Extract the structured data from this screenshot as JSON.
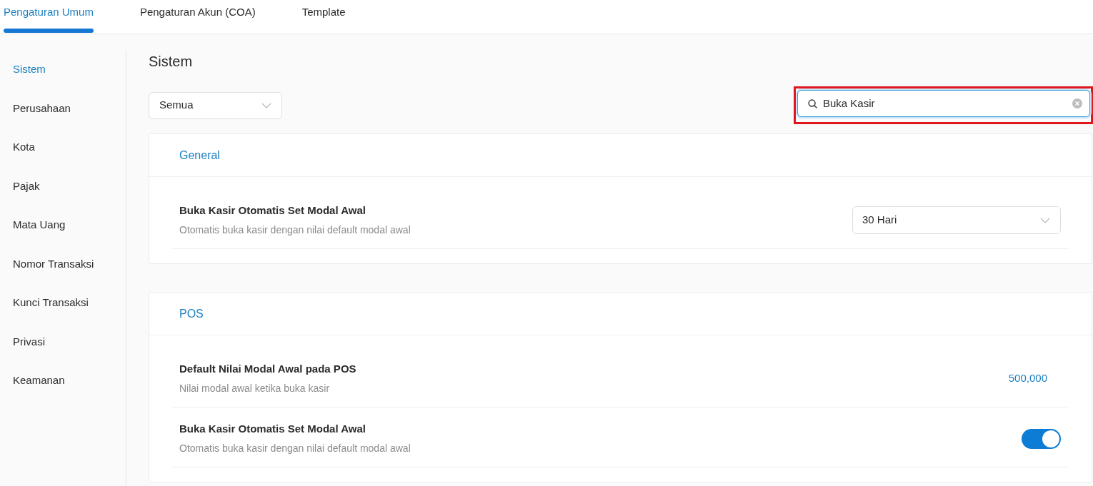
{
  "tabs": [
    {
      "label": "Pengaturan Umum",
      "selected": true
    },
    {
      "label": "Pengaturan Akun (COA)",
      "selected": false
    },
    {
      "label": "Template",
      "selected": false
    }
  ],
  "sidebar": {
    "items": [
      {
        "label": "Sistem",
        "selected": true
      },
      {
        "label": "Perusahaan",
        "selected": false
      },
      {
        "label": "Kota",
        "selected": false
      },
      {
        "label": "Pajak",
        "selected": false
      },
      {
        "label": "Mata Uang",
        "selected": false
      },
      {
        "label": "Nomor Transaksi",
        "selected": false
      },
      {
        "label": "Kunci Transaksi",
        "selected": false
      },
      {
        "label": "Privasi",
        "selected": false
      },
      {
        "label": "Keamanan",
        "selected": false
      }
    ]
  },
  "page": {
    "title": "Sistem",
    "filter": {
      "value": "Semua"
    },
    "search": {
      "value": "Buka Kasir",
      "highlighted": true
    }
  },
  "sections": [
    {
      "title": "General",
      "settings": [
        {
          "kind": "select",
          "title": "Buka Kasir Otomatis Set Modal Awal",
          "description": "Otomatis buka kasir dengan nilai default modal awal",
          "value": "30 Hari"
        }
      ]
    },
    {
      "title": "POS",
      "settings": [
        {
          "kind": "value",
          "title": "Default Nilai Modal Awal pada POS",
          "description": "Nilai modal awal ketika buka kasir",
          "value": "500,000"
        },
        {
          "kind": "toggle",
          "title": "Buka Kasir Otomatis Set Modal Awal",
          "description": "Otomatis buka kasir dengan nilai default modal awal",
          "on": true
        }
      ]
    }
  ]
}
